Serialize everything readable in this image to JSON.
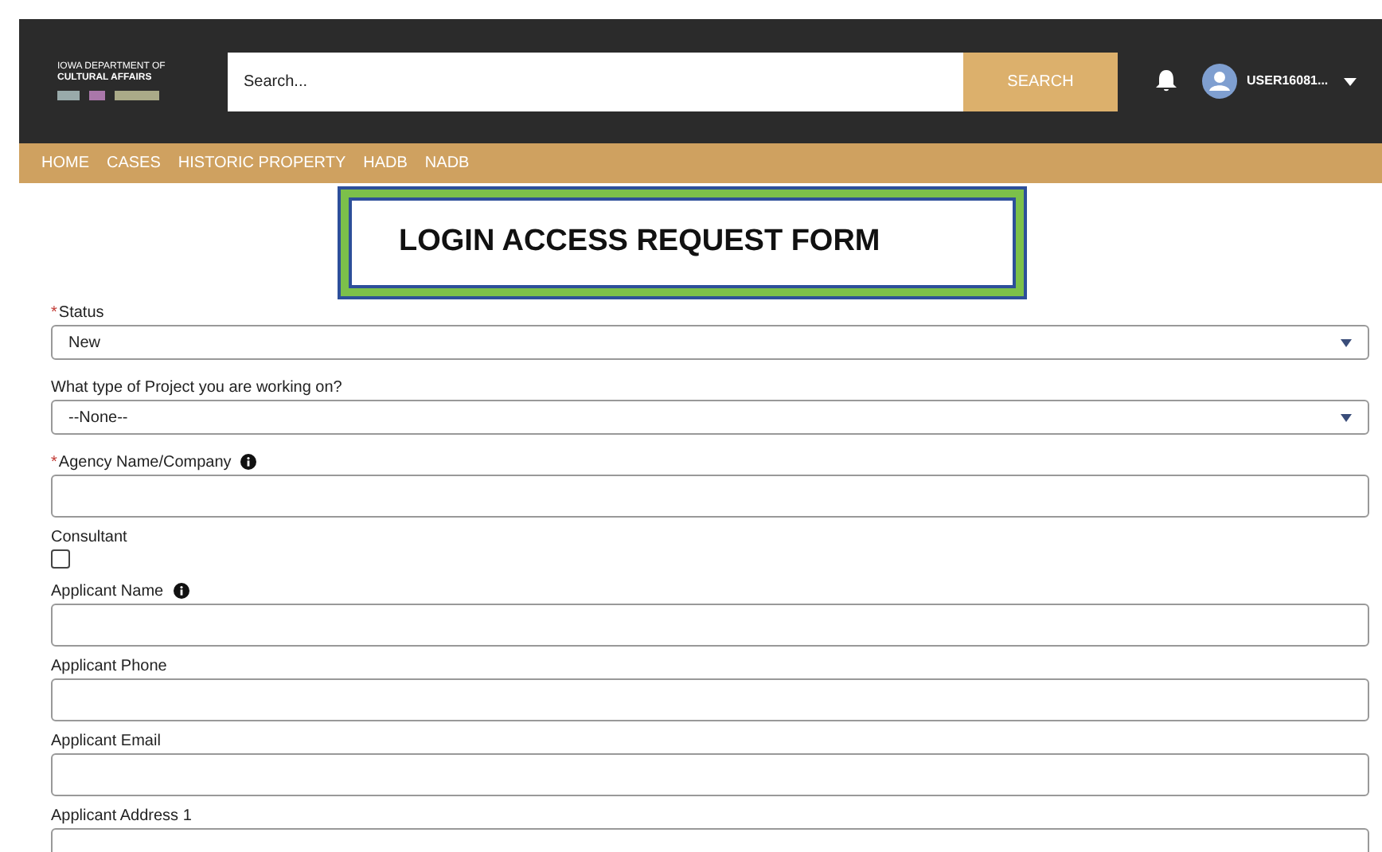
{
  "logo": {
    "line_1": "IOWA DEPARTMENT OF",
    "line_2": "CULTURAL AFFAIRS"
  },
  "search": {
    "placeholder": "Search...",
    "button": "SEARCH"
  },
  "user": {
    "name": "USER16081..."
  },
  "nav": [
    {
      "label": "HOME"
    },
    {
      "label": "CASES"
    },
    {
      "label": "HISTORIC PROPERTY"
    },
    {
      "label": "HADB"
    },
    {
      "label": "NADB"
    }
  ],
  "form_title": "LOGIN ACCESS REQUEST FORM",
  "fields": [
    {
      "kind": "select",
      "label": "Status",
      "required_mark": "*",
      "value": "New"
    },
    {
      "kind": "select",
      "label": "What type of Project you are working on?",
      "value": "--None--"
    },
    {
      "kind": "text",
      "label": "Agency Name/Company",
      "required_mark": "*",
      "info": true
    },
    {
      "kind": "checkbox",
      "label": "Consultant",
      "checked": false
    },
    {
      "kind": "text",
      "label": "Applicant Name",
      "info": true
    },
    {
      "kind": "text",
      "label": "Applicant Phone"
    },
    {
      "kind": "text",
      "label": "Applicant Email"
    },
    {
      "kind": "text",
      "label": "Applicant Address 1"
    }
  ]
}
